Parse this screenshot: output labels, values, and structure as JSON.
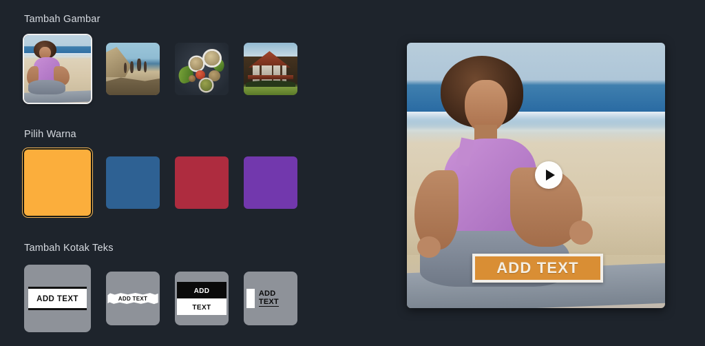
{
  "background_color": "#1e242c",
  "sections": {
    "images": {
      "label": "Tambah Gambar",
      "items": [
        {
          "name": "woman-meditating-beach",
          "selected": true
        },
        {
          "name": "people-jumping-rocky-beach",
          "selected": false
        },
        {
          "name": "healthy-food-flatlay",
          "selected": false
        },
        {
          "name": "house-with-red-roof",
          "selected": false
        }
      ]
    },
    "colors": {
      "label": "Pilih Warna",
      "items": [
        {
          "name": "orange",
          "hex": "#FBAE3C",
          "selected": true
        },
        {
          "name": "blue",
          "hex": "#2E6193",
          "selected": false
        },
        {
          "name": "red",
          "hex": "#AE2C3F",
          "selected": false
        },
        {
          "name": "purple",
          "hex": "#7238AD",
          "selected": false
        }
      ]
    },
    "textboxes": {
      "label": "Tambah Kotak Teks",
      "items": [
        {
          "style": "bar-rules",
          "line1": "ADD TEXT",
          "selected": true
        },
        {
          "style": "brush-stroke",
          "line1": "ADD TEXT",
          "selected": false
        },
        {
          "style": "split-block",
          "line1": "ADD",
          "line2": "TEXT",
          "selected": false
        },
        {
          "style": "vbar-stacked",
          "line1": "ADD",
          "line2": "TEXT",
          "selected": false
        }
      ]
    }
  },
  "preview": {
    "name": "video-preview",
    "play_button": "play-icon",
    "banner": {
      "text": "ADD TEXT",
      "background_color": "#D98E34",
      "border_color": "#F2EFE9",
      "text_color": "#F4EEE2"
    }
  }
}
